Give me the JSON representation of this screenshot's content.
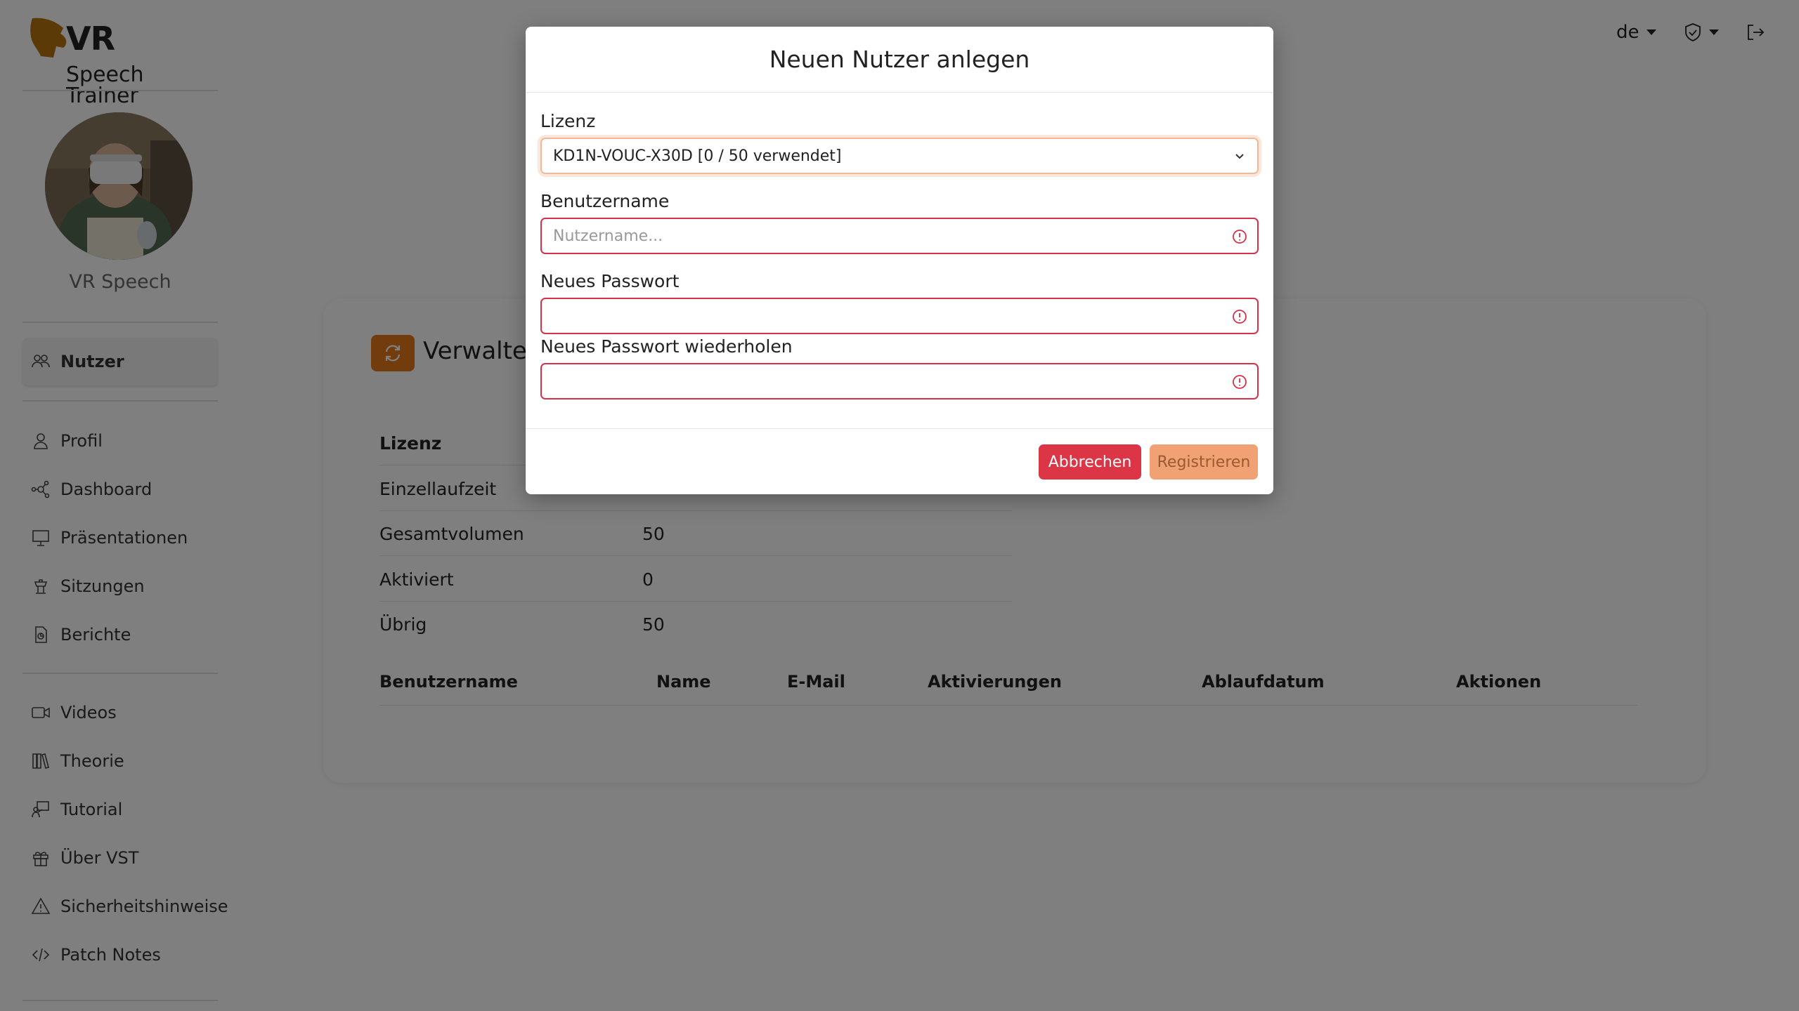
{
  "brand": {
    "title": "VR",
    "subtitle": "Speech Trainer"
  },
  "user": {
    "name": "VR Speech"
  },
  "sidebar": {
    "items": [
      {
        "label": "Nutzer",
        "icon": "users-icon",
        "active": true
      },
      {
        "label": "Profil",
        "icon": "person-icon"
      },
      {
        "label": "Dashboard",
        "icon": "nodes-icon"
      },
      {
        "label": "Präsentationen",
        "icon": "presentation-icon"
      },
      {
        "label": "Sitzungen",
        "icon": "podium-icon"
      },
      {
        "label": "Berichte",
        "icon": "report-icon"
      },
      {
        "label": "Videos",
        "icon": "video-icon"
      },
      {
        "label": "Theorie",
        "icon": "books-icon"
      },
      {
        "label": "Tutorial",
        "icon": "tutorial-icon"
      },
      {
        "label": "Über VST",
        "icon": "gift-icon"
      },
      {
        "label": "Sicherheitshinweise",
        "icon": "warning-icon"
      },
      {
        "label": "Patch Notes",
        "icon": "code-icon"
      }
    ]
  },
  "topbar": {
    "language": "de"
  },
  "card": {
    "title": "Verwaltete",
    "info": [
      {
        "key": "Lizenz",
        "value": ""
      },
      {
        "key": "Einzellaufzeit",
        "value": ""
      },
      {
        "key": "Gesamtvolumen",
        "value": "50"
      },
      {
        "key": "Aktiviert",
        "value": "0"
      },
      {
        "key": "Übrig",
        "value": "50"
      }
    ],
    "table_columns": [
      "Benutzername",
      "Name",
      "E-Mail",
      "Aktivierungen",
      "Ablaufdatum",
      "Aktionen"
    ]
  },
  "modal": {
    "title": "Neuen Nutzer anlegen",
    "license_label": "Lizenz",
    "license_value": "KD1N-VOUC-X30D [0 / 50 verwendet]",
    "username_label": "Benutzername",
    "username_placeholder": "Nutzername...",
    "password_label": "Neues Passwort",
    "password_repeat_label": "Neues Passwort wiederholen",
    "cancel_label": "Abbrechen",
    "register_label": "Registrieren"
  },
  "colors": {
    "accent": "#e5781a",
    "danger": "#dc3545",
    "register": "#f0a275"
  }
}
